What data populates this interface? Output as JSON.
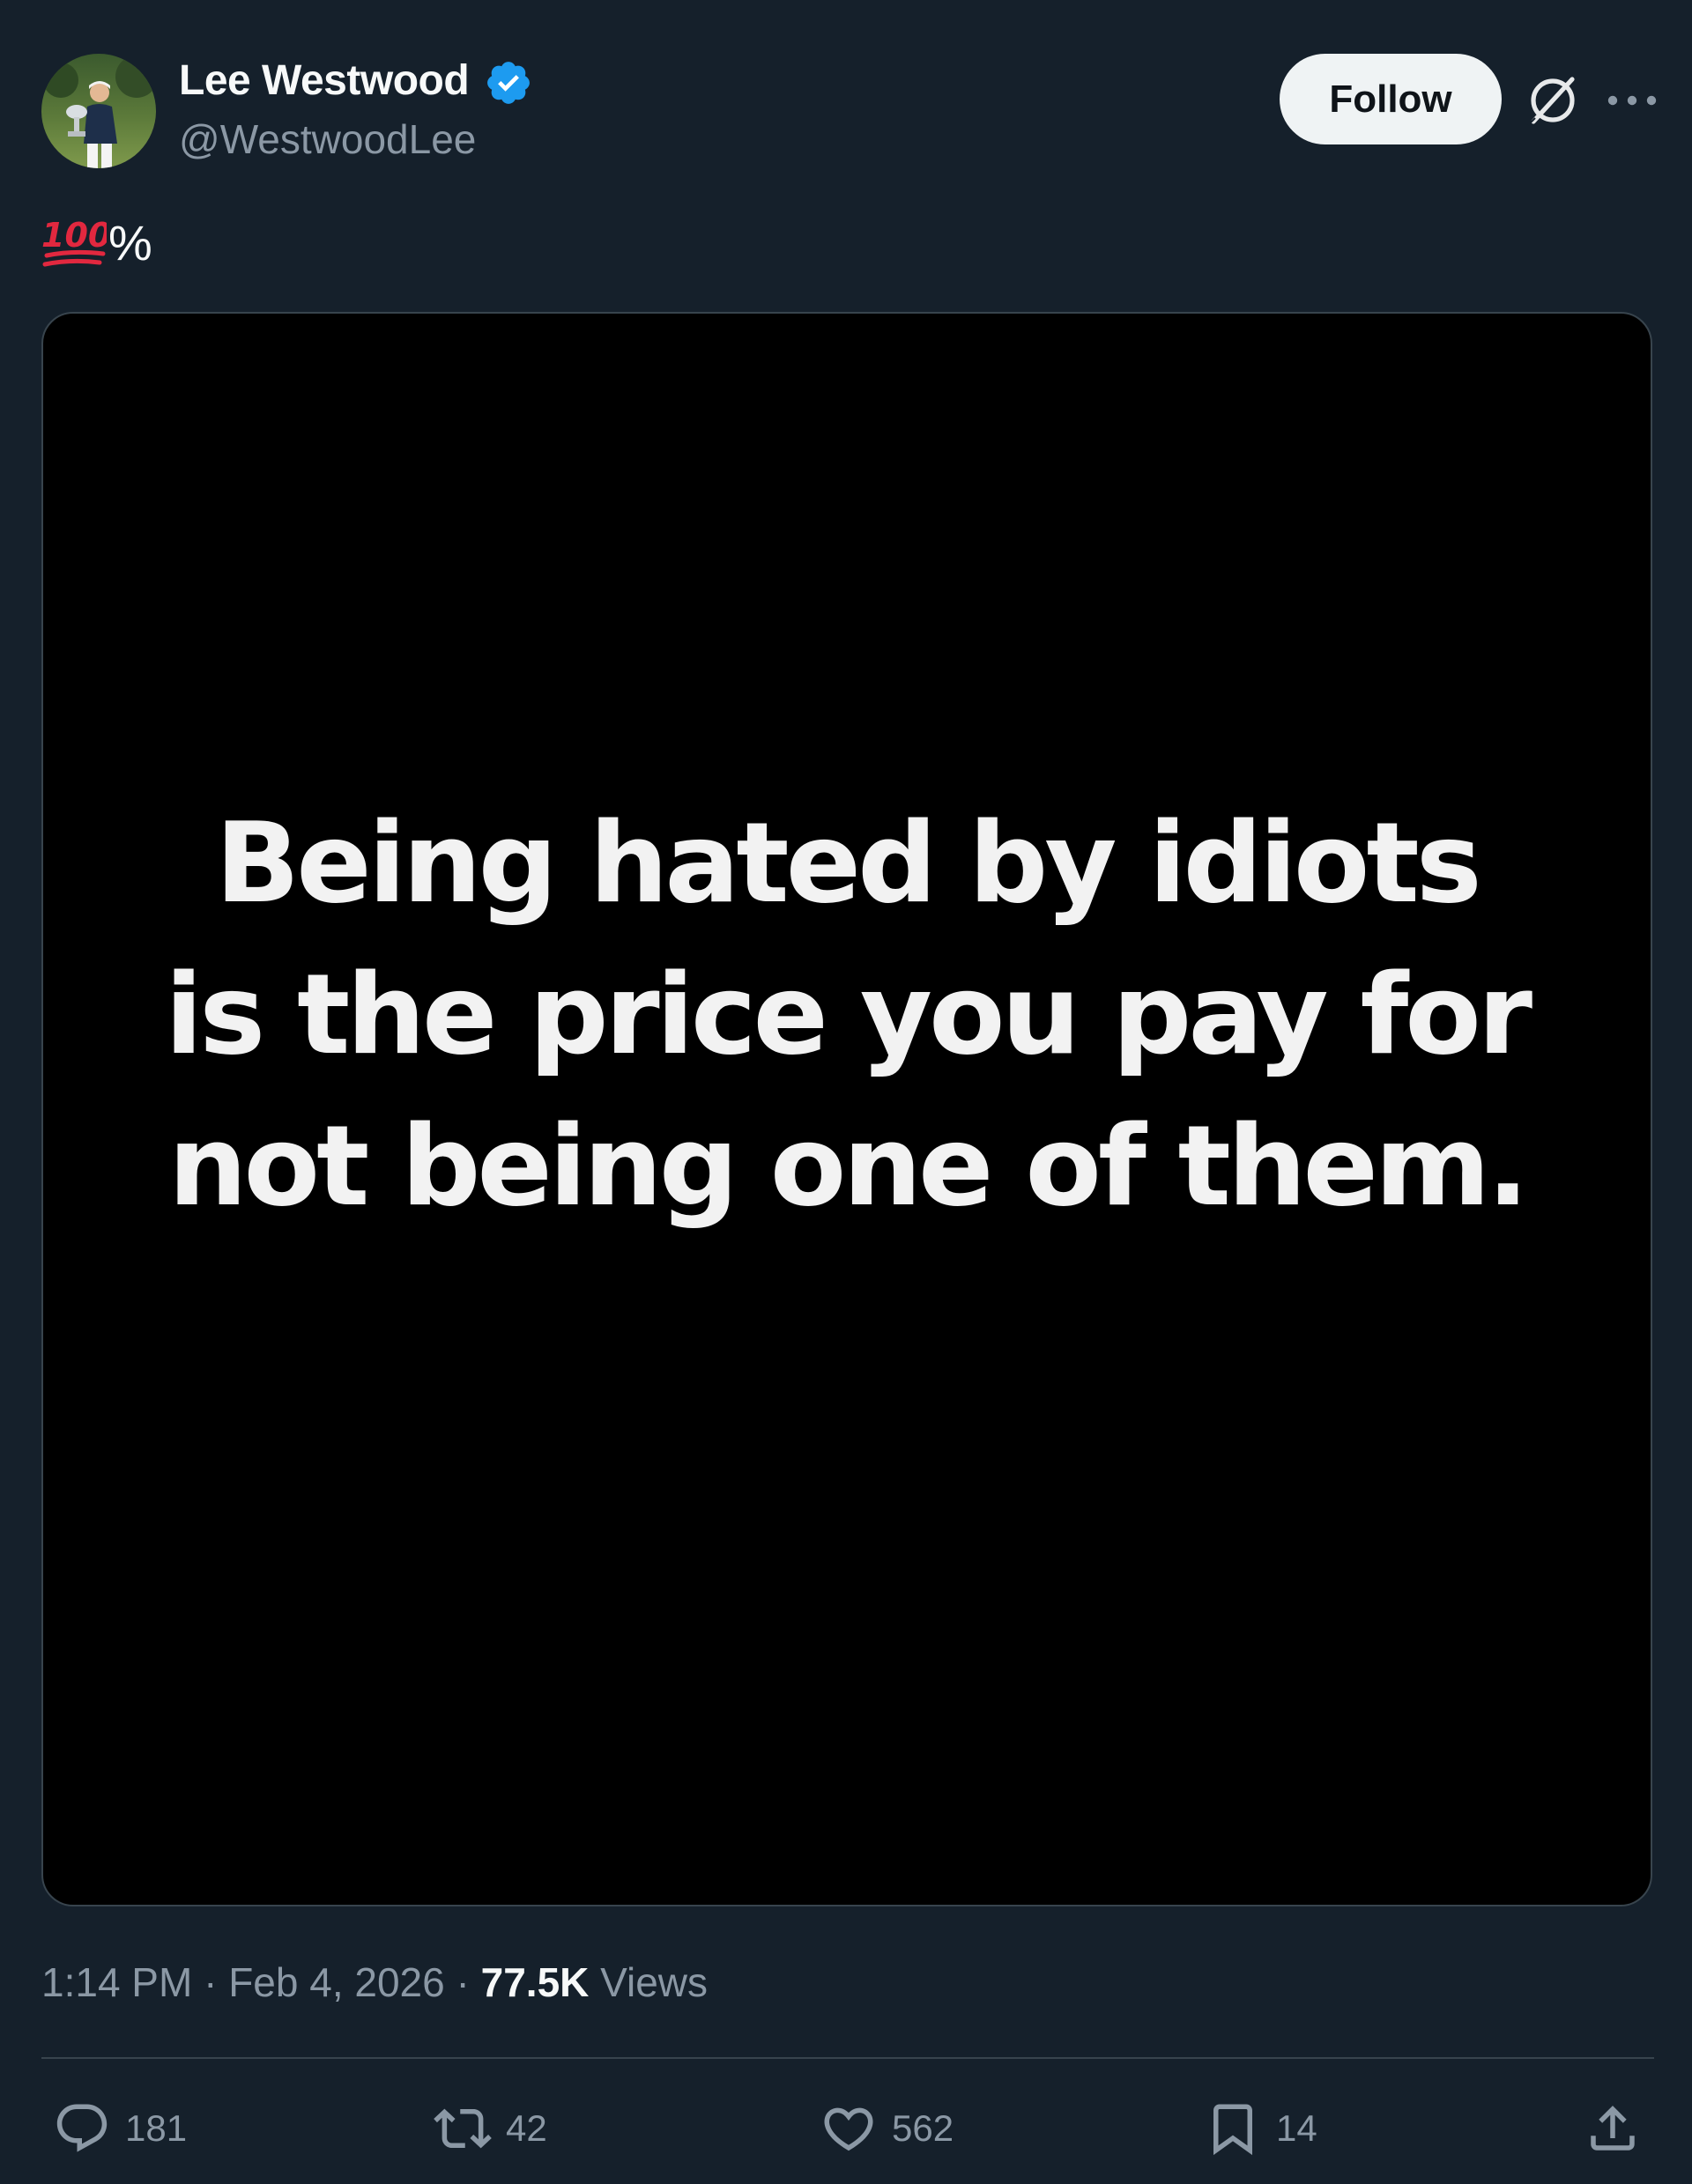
{
  "author": {
    "display_name": "Lee Westwood",
    "handle": "@WestwoodLee",
    "verified": true,
    "avatar": "golfer-holding-trophy"
  },
  "header": {
    "follow_label": "Follow",
    "grok_icon": "grok-icon",
    "more_icon": "more-options-icon"
  },
  "tweet": {
    "text_emoji": "hundred-points-emoji",
    "text": "%",
    "media": {
      "caption_lines": [
        "Being hated by idiots",
        "is the price you pay for",
        "not being one of them."
      ],
      "background_color": "#000000"
    }
  },
  "meta": {
    "time": "1:14 PM",
    "separator": "·",
    "date": "Feb 4, 2026",
    "views_count": "77.5K",
    "views_label": "Views"
  },
  "actions": {
    "replies": "181",
    "reposts": "42",
    "likes": "562",
    "bookmarks": "14"
  },
  "colors": {
    "background": "#15202b",
    "verified_blue": "#1d9bf0",
    "secondary_text": "#8b98a5",
    "hundred_red": "#e2283f"
  }
}
